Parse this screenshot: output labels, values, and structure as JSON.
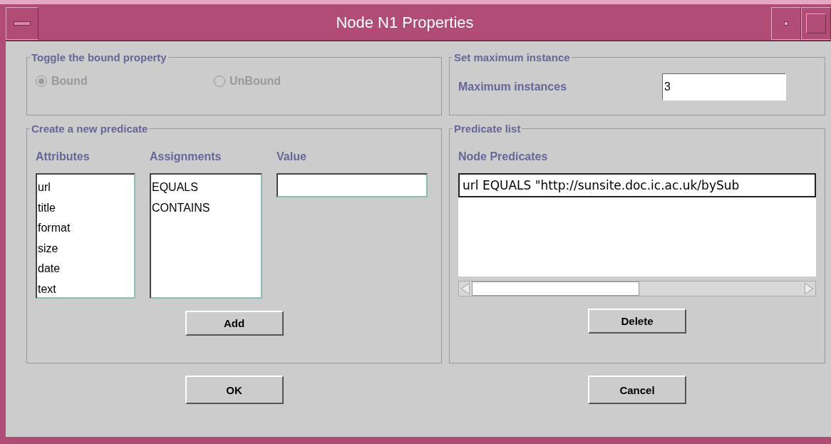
{
  "window": {
    "title": "Node N1 Properties"
  },
  "bound_group": {
    "legend": "Toggle the bound property",
    "options": [
      {
        "label": "Bound",
        "selected": true,
        "disabled": true
      },
      {
        "label": "UnBound",
        "selected": false,
        "disabled": true
      }
    ]
  },
  "max_group": {
    "legend": "Set maximum instance",
    "label": "Maximum instances",
    "value": "3"
  },
  "create_group": {
    "legend": "Create a new predicate",
    "attributes_label": "Attributes",
    "assignments_label": "Assignments",
    "value_label": "Value",
    "attributes": [
      "url",
      "title",
      "format",
      "size",
      "date",
      "text"
    ],
    "assignments": [
      "EQUALS",
      "CONTAINS"
    ],
    "add_button": "Add"
  },
  "predicate_group": {
    "legend": "Predicate list",
    "label": "Node Predicates",
    "predicates": [
      "url EQUALS \"http://sunsite.doc.ic.ac.uk/bySub"
    ],
    "delete_button": "Delete"
  },
  "buttons": [
    "OK",
    "Cancel"
  ]
}
